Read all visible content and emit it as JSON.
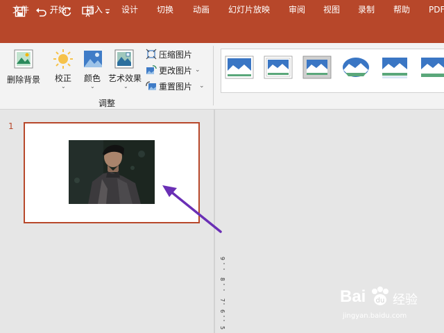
{
  "quick_access": {
    "icons": [
      "save-icon",
      "undo-icon",
      "redo-icon",
      "presentation-icon",
      "customize-icon"
    ]
  },
  "tabs": [
    {
      "label": "文件"
    },
    {
      "label": "开始"
    },
    {
      "label": "插入"
    },
    {
      "label": "设计"
    },
    {
      "label": "切换"
    },
    {
      "label": "动画"
    },
    {
      "label": "幻灯片放映"
    },
    {
      "label": "审阅"
    },
    {
      "label": "视图"
    },
    {
      "label": "录制"
    },
    {
      "label": "帮助"
    },
    {
      "label": "PDF"
    }
  ],
  "ribbon": {
    "remove_background": "删除背景",
    "corrections": "校正",
    "color": "颜色",
    "artistic_effects": "艺术效果",
    "compress_pictures": "压缩图片",
    "change_picture": "更改图片",
    "reset_picture": "重置图片",
    "group_label": "调整"
  },
  "slides": [
    {
      "number": "1"
    }
  ],
  "ruler": {
    "numbers": [
      "9",
      "8",
      "7",
      "6",
      "5"
    ]
  },
  "watermark": {
    "brand": "Bai",
    "brand2": "经验",
    "url": "jingyan.baidu.com"
  },
  "colors": {
    "accent": "#b7472a",
    "arrow": "#6a2fb5"
  }
}
